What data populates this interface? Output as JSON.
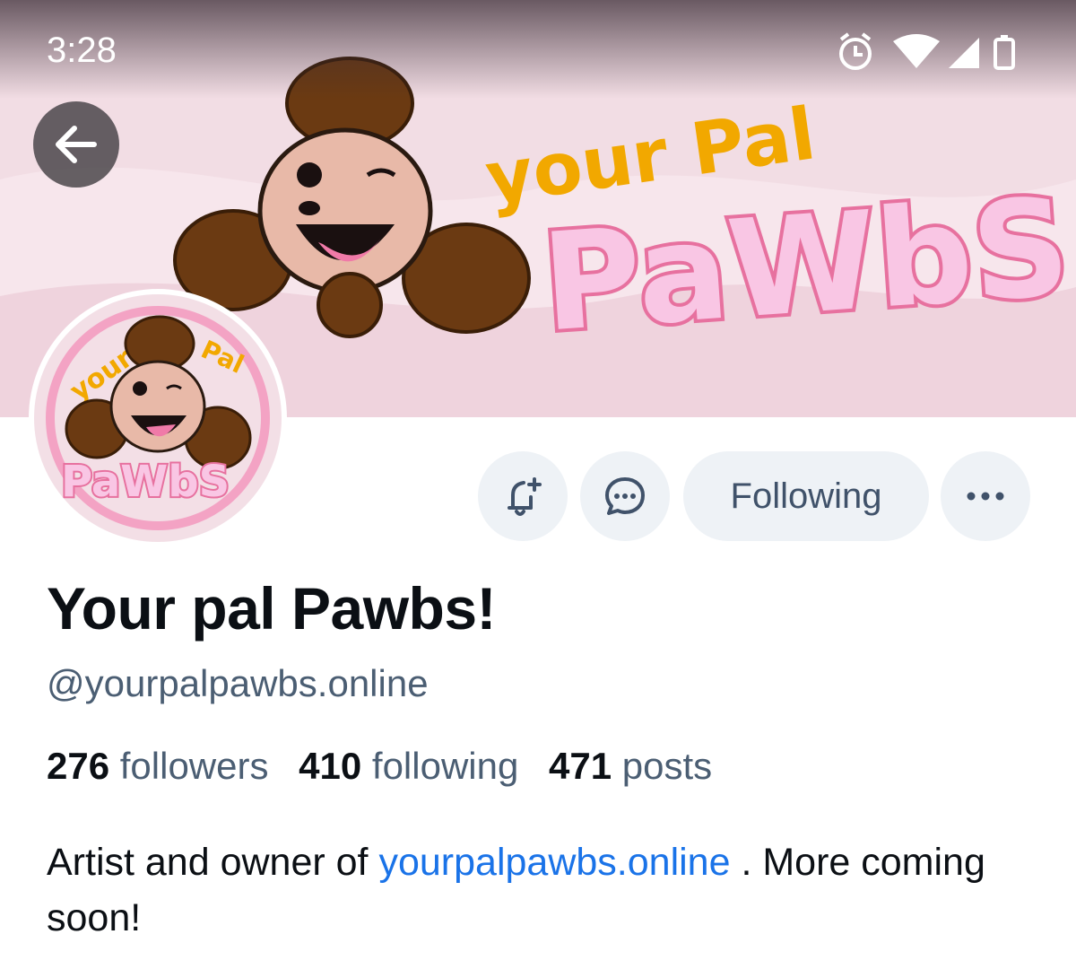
{
  "status_bar": {
    "time": "3:28"
  },
  "banner": {
    "logo_line1": "your Pal",
    "logo_line2": "PaWbS",
    "accent": "#f2a800"
  },
  "avatar": {
    "logo_top_left": "your",
    "logo_top_right": "Pal",
    "logo_bottom": "PaWbS"
  },
  "actions": {
    "follow_label": "Following"
  },
  "profile": {
    "display_name": "Your pal Pawbs!",
    "handle": "@yourpalpawbs.online",
    "followers_count": "276",
    "followers_label": "followers",
    "following_count": "410",
    "following_label": "following",
    "posts_count": "471",
    "posts_label": "posts",
    "bio_prefix": "Artist and owner of ",
    "bio_link": "yourpalpawbs.online",
    "bio_suffix": " . More coming soon!"
  },
  "colors": {
    "link": "#1a73e8",
    "button_bg": "#eef2f6",
    "muted_text": "#4b5e73"
  }
}
